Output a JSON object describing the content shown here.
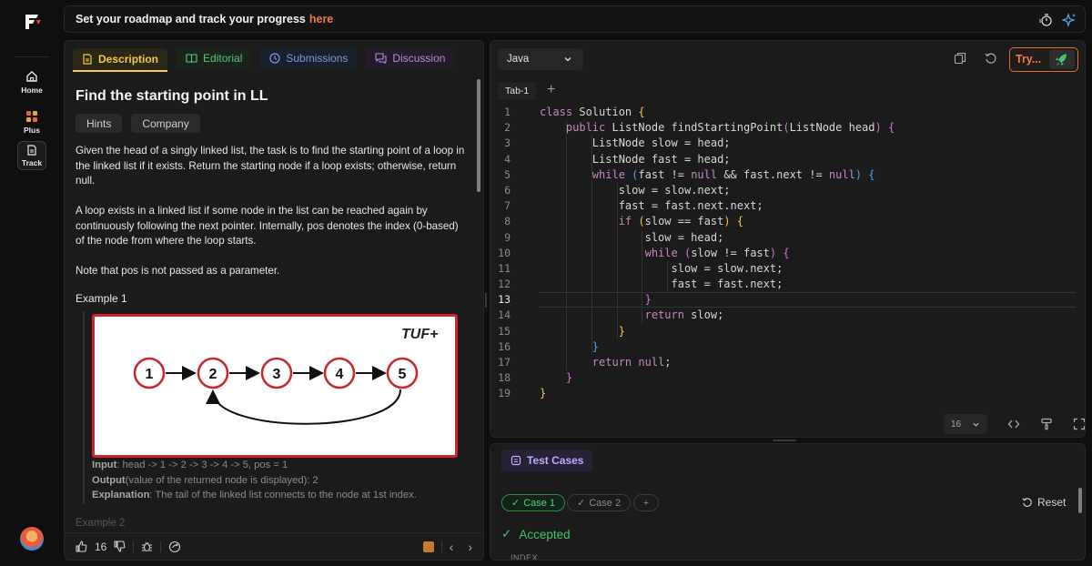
{
  "app": {
    "brand_color": "#f07a45"
  },
  "topbar": {
    "message": "Set your roadmap and track your progress",
    "link": "here"
  },
  "rail": {
    "items": [
      {
        "label": "Home",
        "icon": "home-icon"
      },
      {
        "label": "Plus",
        "icon": "plus-grid-icon"
      },
      {
        "label": "Track",
        "icon": "document-icon"
      }
    ]
  },
  "description": {
    "tabs": [
      {
        "label": "Description",
        "icon": "document-icon"
      },
      {
        "label": "Editorial",
        "icon": "book-icon"
      },
      {
        "label": "Submissions",
        "icon": "clock-icon"
      },
      {
        "label": "Discussion",
        "icon": "chat-icon"
      }
    ],
    "title": "Find the starting point in LL",
    "chips": [
      "Hints",
      "Company"
    ],
    "para1": "Given the head of a singly linked list, the task is to find the starting point of a loop in the linked list if it exists. Return the starting node if a loop exists; otherwise, return null.",
    "para2": "A loop exists in a linked list if some node in the list can be reached again by continuously following the next pointer. Internally, pos denotes the index (0-based) of the node from where the loop starts.",
    "para3": "Note that pos is not passed as a parameter.",
    "example1_label": "Example 1",
    "example_image": {
      "watermark": "TUF+",
      "nodes": [
        "1",
        "2",
        "3",
        "4",
        "5"
      ]
    },
    "input_label": "Input",
    "input_value": ": head -> 1 -> 2 -> 3 -> 4 -> 5, pos = 1",
    "output_label": "Output",
    "output_value": "(value of the returned node is displayed): 2",
    "explanation_label": "Explanation",
    "explanation_value": ": The tail of the linked list connects to the node at 1st index.",
    "example2_label": "Example 2",
    "likes": "16"
  },
  "editor": {
    "language": "Java",
    "try_label": "Try...",
    "file_tab": "Tab-1",
    "font_size": "16",
    "current_line": 13,
    "lines": [
      "class Solution {",
      "    public ListNode findStartingPoint(ListNode head) {",
      "        ListNode slow = head;",
      "        ListNode fast = head;",
      "        while (fast != null && fast.next != null) {",
      "            slow = slow.next;",
      "            fast = fast.next.next;",
      "            if (slow == fast) {",
      "                slow = head;",
      "                while (slow != fast) {",
      "                    slow = slow.next;",
      "                    fast = fast.next;",
      "                }",
      "                return slow;",
      "            }",
      "        }",
      "        return null;",
      "    }",
      "}"
    ]
  },
  "tests": {
    "tab_label": "Test Cases",
    "cases": [
      "Case 1",
      "Case 2"
    ],
    "reset_label": "Reset",
    "status": "Accepted",
    "index_label": "INDEX"
  }
}
